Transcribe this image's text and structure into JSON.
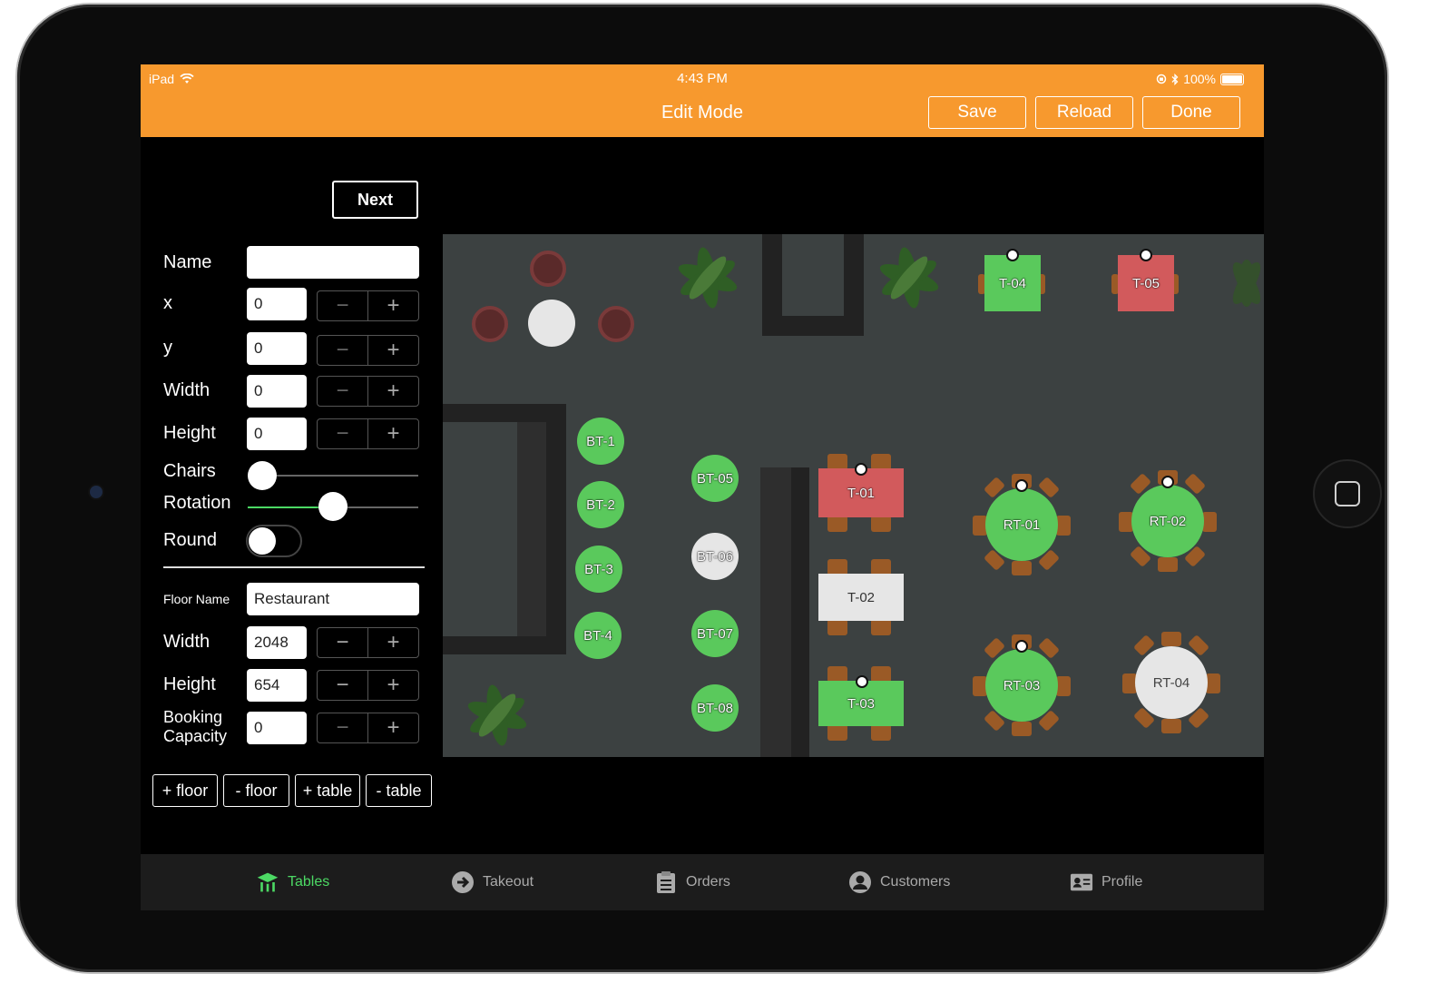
{
  "status_bar": {
    "device": "iPad",
    "time": "4:43 PM",
    "battery": "100%"
  },
  "header": {
    "title": "Edit Mode",
    "save_label": "Save",
    "reload_label": "Reload",
    "done_label": "Done"
  },
  "colors": {
    "accent": "#f7992e",
    "available": "#5ac95c",
    "occupied": "#d25a5c",
    "free": "#e6e6e6",
    "active_tab": "#4cd964"
  },
  "table_form": {
    "next_label": "Next",
    "name_label": "Name",
    "name_value": "",
    "x_label": "x",
    "x_value": "0",
    "y_label": "y",
    "y_value": "0",
    "width_label": "Width",
    "width_value": "0",
    "height_label": "Height",
    "height_value": "0",
    "chairs_label": "Chairs",
    "chairs_level": 0,
    "rotation_label": "Rotation",
    "rotation_level": 0.5,
    "round_label": "Round",
    "round_on": false
  },
  "floor_form": {
    "floor_name_label": "Floor Name",
    "floor_name_value": "Restaurant",
    "width_label": "Width",
    "width_value": "2048",
    "height_label": "Height",
    "height_value": "654",
    "booking_label_1": "Booking",
    "booking_label_2": "Capacity",
    "booking_value": "0"
  },
  "actions": {
    "add_floor": "+ floor",
    "remove_floor": "- floor",
    "add_table": "+ table",
    "remove_table": "- table"
  },
  "tables": {
    "t04": "T-04",
    "t05": "T-05",
    "t01": "T-01",
    "t02": "T-02",
    "t03": "T-03",
    "bt1": "BT-1",
    "bt2": "BT-2",
    "bt3": "BT-3",
    "bt4": "BT-4",
    "bt05": "BT-05",
    "bt06": "BT-06",
    "bt07": "BT-07",
    "bt08": "BT-08",
    "rt01": "RT-01",
    "rt02": "RT-02",
    "rt03": "RT-03",
    "rt04": "RT-04"
  },
  "tabbar": {
    "tables": "Tables",
    "takeout": "Takeout",
    "orders": "Orders",
    "customers": "Customers",
    "profile": "Profile"
  }
}
